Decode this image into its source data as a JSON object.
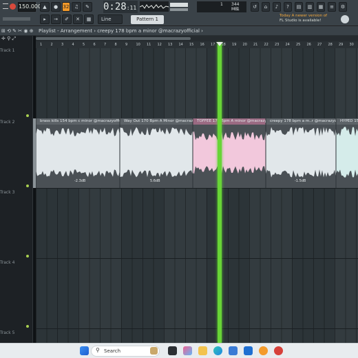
{
  "toolbar": {
    "tempo": "150.000",
    "time_main": "0:28",
    "time_sub": "11",
    "pattern": "Pattern 1",
    "snap": "Line",
    "memory": "344 MB",
    "cpu_line1": "1",
    "cpu_line2": "1",
    "news_line1": "Today  A newer version of",
    "news_line2": "FL Studio is available!",
    "accent_color": "#f39a2a"
  },
  "playlist": {
    "title": "Playlist - Arrangement › creepy 178 bpm a minor @macrazyofficial ›"
  },
  "ruler": {
    "ticks": [
      "1",
      "2",
      "3",
      "4",
      "5",
      "6",
      "7",
      "8",
      "9",
      "10",
      "11",
      "12",
      "13",
      "14",
      "15",
      "16",
      "17",
      "18",
      "19",
      "20",
      "21",
      "22",
      "23",
      "24",
      "25",
      "26",
      "27",
      "28",
      "29",
      "30"
    ]
  },
  "tracks": [
    "Track 1",
    "Track 2",
    "Track 3",
    "Track 4",
    "Track 5"
  ],
  "clips": [
    {
      "name": "brass kills 154 bpm c minor @macrazyofficial",
      "db": "-2.3dB",
      "color": "#e1e7ea"
    },
    {
      "name": "Way Out 170 Bpm A Minor @macrazyofficial",
      "db": "5.6dB",
      "color": "#e1e7ea"
    },
    {
      "name": "TOFFEE 171 Bpm A minor @macrazyofficial",
      "db": "",
      "color": "#f2c8dc"
    },
    {
      "name": "creepy 178 bpm a m..r @macrazyofficial",
      "db": "-1.5dB",
      "color": "#e1e7ea"
    },
    {
      "name": "HYPED 154",
      "db": "",
      "color": "#d5ecea"
    }
  ],
  "taskbar": {
    "search_placeholder": "Search"
  }
}
